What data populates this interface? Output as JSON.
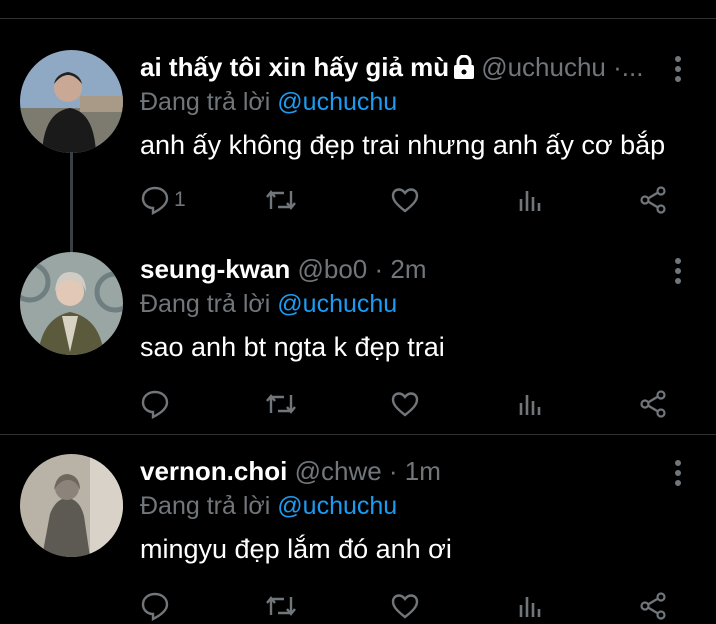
{
  "colors": {
    "background": "#000000",
    "muted": "#71767b",
    "accent": "#1d9bf0",
    "divider": "#2f3336"
  },
  "tweets": [
    {
      "name": "ai thấy tôi xin hấy giả mù",
      "handle": "@uchuchu ·...",
      "time": "",
      "locked": true,
      "reply_label": "Đang trả lời",
      "reply_mention": "@uchuchu",
      "text": "anh ấy không đẹp trai nhưng anh ấy cơ bắp",
      "reply_count": "1",
      "icons": [
        "reply-icon",
        "retweet-icon",
        "like-icon",
        "views-icon",
        "share-icon",
        "more-icon"
      ]
    },
    {
      "name": "seung-kwan",
      "handle": "@bo0 · 2m",
      "locked": false,
      "reply_label": "Đang trả lời",
      "reply_mention": "@uchuchu",
      "text": "sao anh bt ngta k đẹp trai",
      "reply_count": "",
      "icons": [
        "reply-icon",
        "retweet-icon",
        "like-icon",
        "views-icon",
        "share-icon",
        "more-icon"
      ]
    },
    {
      "name": "vernon.choi",
      "handle": "@chwe · 1m",
      "locked": false,
      "reply_label": "Đang trả lời",
      "reply_mention": "@uchuchu",
      "text": "mingyu đẹp lắm đó anh ơi",
      "reply_count": "",
      "icons": [
        "reply-icon",
        "retweet-icon",
        "like-icon",
        "views-icon",
        "share-icon",
        "more-icon"
      ]
    }
  ]
}
